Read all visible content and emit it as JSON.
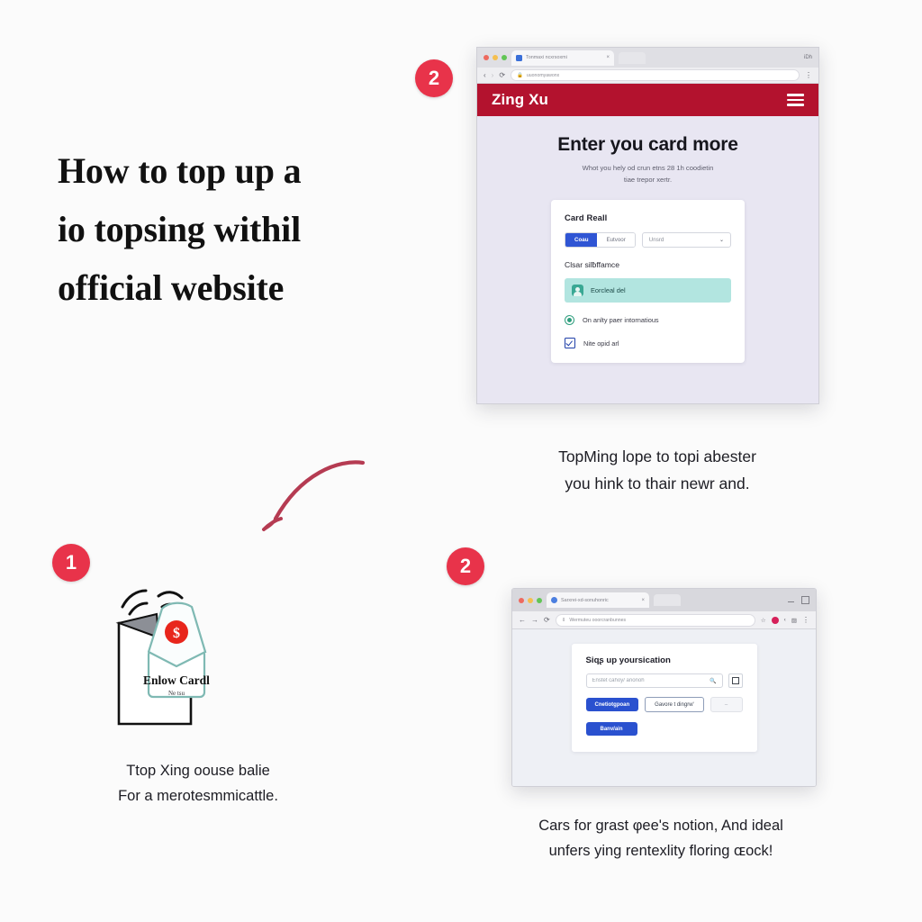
{
  "headline": {
    "lines": [
      "How to top up a",
      "io topsing withil",
      "official website"
    ]
  },
  "badges": {
    "step_one": "1",
    "step_two_top": "2",
    "step_two_bottom": "2",
    "color": "#e8334a"
  },
  "browser_top": {
    "tab": {
      "title": "Tonmaxi ncxrsoxmi",
      "close": "×"
    },
    "tabstrip_right": "iDh",
    "nav": {
      "back": "‹",
      "forward": "›",
      "reload": "⟳"
    },
    "url": "uuonomyawonx",
    "lock_icon": "lock-icon",
    "omnibar_right": "⋮",
    "site": {
      "logo": "Zing Xu",
      "header_color": "#b3122e",
      "menu_icon": "hamburger-icon"
    },
    "page": {
      "title": "Enter you card more",
      "subtitle_lines": [
        "Whot you hely od crun etns  28 1h coodietin",
        "tiae trepor xertr."
      ],
      "card": {
        "title": "Card Reall",
        "segments": [
          {
            "label": "Coau",
            "active": true
          },
          {
            "label": "Eutvoor",
            "active": false
          }
        ],
        "select_value": "Unsrd",
        "select_caret": "⌄",
        "sub_label": "Clsar silƀffamce",
        "highlight_row": {
          "icon": "avatar-icon",
          "text": "Eorcleal del",
          "color": "#b2e5e0"
        },
        "radio_option": {
          "label": "On anlty paer intornatious",
          "selected": true,
          "color": "#2f9e7e"
        },
        "checkbox_option": {
          "label": "Nite opid arl",
          "checked": true,
          "color": "#1f3fa8"
        }
      }
    }
  },
  "browser_bottom": {
    "tab": {
      "title": "Sarxrei-xd-sonuhonric",
      "close": "×"
    },
    "window_controls": {
      "minimize": "minimize-icon",
      "maximize": "maximize-icon"
    },
    "nav": {
      "back": "←",
      "forward": "→",
      "reload": "⟳"
    },
    "url": "Wermuteu ooorcranbunnes",
    "download_icon": "download-icon",
    "omnibar_right": {
      "star": "☆",
      "extension_badge": "⊖",
      "profile": "‹",
      "puzzle": "▨",
      "kebab": "⋮"
    },
    "page": {
      "card": {
        "title": "Siqʂ up yoursication",
        "search_placeholder": "Enstet cahoy/ anonoh",
        "search_icon": "search-icon",
        "square_button": "square-icon",
        "buttons": [
          {
            "label": "Cnetiotgpoan",
            "style": "primary"
          },
          {
            "label": "Gavore t dingrw'",
            "style": "outline"
          },
          {
            "label": "–",
            "style": "ghost"
          }
        ],
        "second_row_button": {
          "label": "Banv/ain",
          "style": "primary"
        }
      }
    }
  },
  "illustration": {
    "name": "open-envelope-with-card",
    "card_title": "Enlow Cardl",
    "card_subtitle": "Ne tsu",
    "seal": {
      "name": "dollar-seal-icon",
      "glyph": "$",
      "color": "#e8261c"
    },
    "envelope_color": "#7fb9b3"
  },
  "arrow": {
    "name": "curved-arrow-down-left",
    "color": "#b53b52"
  },
  "captions": {
    "top_right": [
      "TopMing lope to topi abester",
      "you hink to thair newr and."
    ],
    "bottom_left": [
      "Ttop Xing oouse balie",
      "For a merotesmmicattle."
    ],
    "bottom_right": [
      "Cars for grast φeeʹs notion, And ideal",
      "unfers ying rentexlity floring ɶock!"
    ]
  }
}
